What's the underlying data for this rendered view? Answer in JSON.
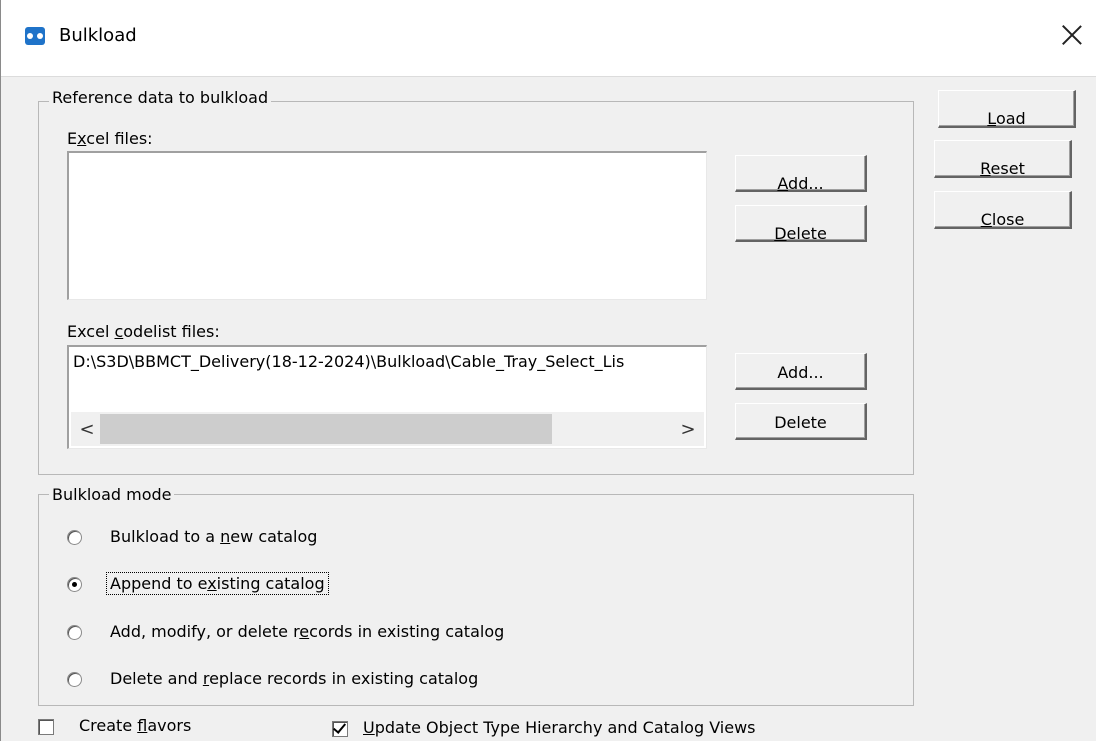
{
  "window": {
    "title": "Bulkload",
    "icon": "bulkload-app-icon",
    "close_icon": "close-icon"
  },
  "reference_group": {
    "label": "Reference data to bulkload",
    "excel_files": {
      "label_pre": "E",
      "label_key": "x",
      "label_post": "cel files:",
      "items": [],
      "add_pre": "",
      "add_key": "A",
      "add_post": "dd...",
      "delete_pre": "",
      "delete_key": "D",
      "delete_post": "elete"
    },
    "codelist_files": {
      "label_pre": "Excel ",
      "label_key": "c",
      "label_post": "odelist files:",
      "items": [
        "D:\\S3D\\BBMCT_Delivery(18-12-2024)\\Bulkload\\Cable_Tray_Select_Lis"
      ],
      "scroll_left": "<",
      "scroll_right": ">",
      "add_label": "Add...",
      "delete_label": "Delete"
    }
  },
  "side_buttons": {
    "load_key": "L",
    "load_post": "oad",
    "reset_key": "R",
    "reset_post": "eset",
    "close_key": "C",
    "close_post": "lose"
  },
  "mode_group": {
    "label": "Bulkload mode",
    "selected_index": 1,
    "options": [
      {
        "pre": "Bulkload to a ",
        "key": "n",
        "post": "ew catalog"
      },
      {
        "pre": "Append to e",
        "key": "x",
        "post": "isting  catalog"
      },
      {
        "pre": "Add, modify, or delete r",
        "key": "e",
        "post": "cords in existing catalog"
      },
      {
        "pre": "Delete and ",
        "key": "r",
        "post": "eplace records in existing catalog"
      }
    ]
  },
  "options": {
    "create_flavors": {
      "pre": "Create ",
      "key": "f",
      "post": "lavors",
      "checked": false
    },
    "update_hierarchy": {
      "pre": "",
      "key": "U",
      "post": "pdate Object Type Hierarchy and Catalog Views",
      "checked": true
    }
  }
}
